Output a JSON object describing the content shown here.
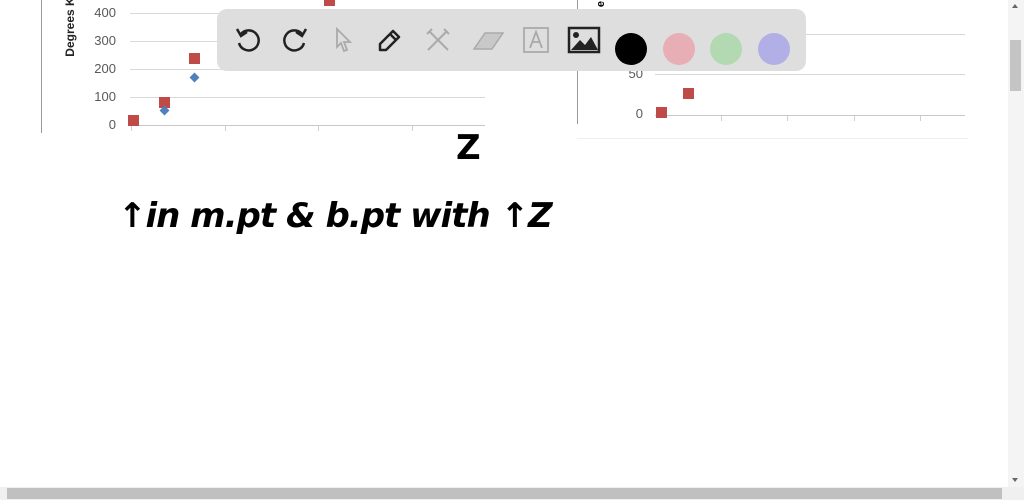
{
  "left_chart": {
    "y_axis_label": "Degrees K",
    "y_ticks": [
      "400",
      "300",
      "200",
      "100",
      "0"
    ]
  },
  "right_chart": {
    "y_axis_label_fragment": "e",
    "y_ticks": [
      "50",
      "0"
    ]
  },
  "annotations": {
    "axis_letter": "Z",
    "note": "↑in m.pt & b.pt with ↑Z"
  },
  "toolbar": {
    "tools": [
      "undo",
      "redo",
      "select",
      "pen",
      "tools",
      "eraser",
      "text",
      "image"
    ],
    "colors": [
      "#000000",
      "#e8aeb5",
      "#b3d9b3",
      "#b2aee6"
    ]
  },
  "series_colors": {
    "melting": "#4f81bd",
    "boiling": "#be4b48"
  }
}
